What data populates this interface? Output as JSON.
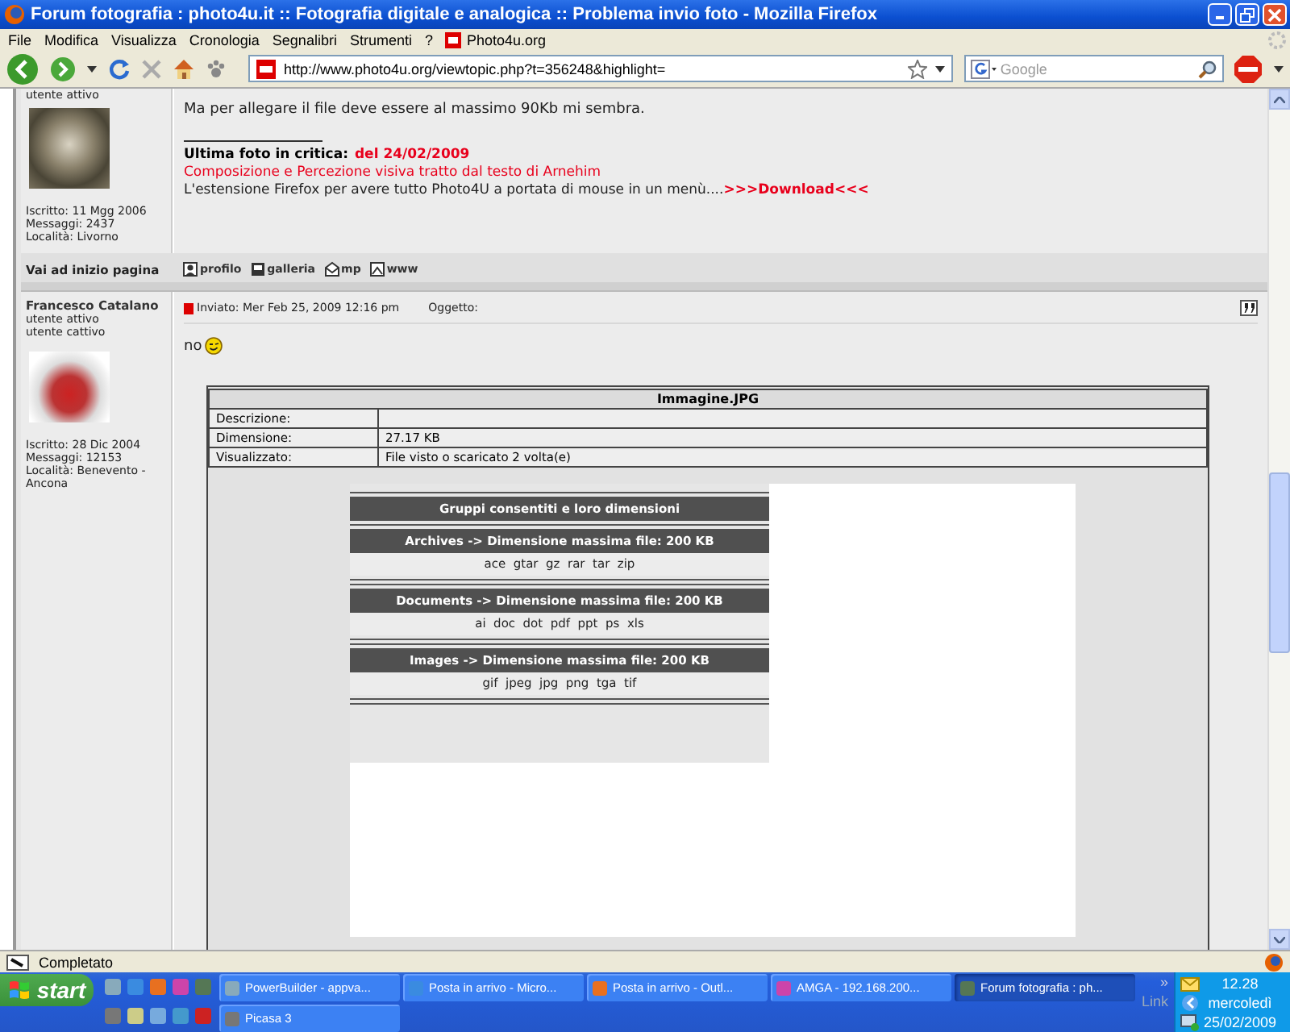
{
  "window": {
    "title": "Forum fotografia : photo4u.it :: Fotografia digitale e analogica :: Problema invio foto - Mozilla Firefox"
  },
  "menu": [
    "File",
    "Modifica",
    "Visualizza",
    "Cronologia",
    "Segnalibri",
    "Strumenti",
    "?",
    "Photo4u.org"
  ],
  "toolbar": {
    "url": "http://www.photo4u.org/viewtopic.php?t=356248&highlight=",
    "search_placeholder": "Google"
  },
  "posts": [
    {
      "ranks": [
        "utente attivo"
      ],
      "stats": [
        "Iscritto: 11 Mgg 2006",
        "Messaggi: 2437",
        "Località: Livorno"
      ],
      "message": "Ma per allegare il file deve essere al massimo 90Kb mi sembra.",
      "signature": {
        "label": "Ultima foto in critica:",
        "label_link": "del 24/02/2009",
        "link": "Composizione e Percezione visiva tratto dal testo di Arnehim",
        "note": "L'estensione Firefox per avere tutto Photo4U a portata di mouse in un menù....",
        "note_link": ">>>Download<<<"
      },
      "back_to_top": "Vai ad inizio pagina",
      "actions": [
        "profilo",
        "galleria",
        "mp",
        "www"
      ]
    },
    {
      "author": "Francesco Catalano",
      "ranks": [
        "utente attivo",
        "utente cattivo"
      ],
      "stats": [
        "Iscritto: 28 Dic 2004",
        "Messaggi: 12153",
        "Località: Benevento - Ancona"
      ],
      "posted": "Inviato: Mer Feb 25, 2009 12:16 pm",
      "subject_label": "Oggetto:",
      "message": "no",
      "attachment": {
        "filename": "Immagine.JPG",
        "rows": [
          {
            "label": "Descrizione:",
            "value": ""
          },
          {
            "label": "Dimensione:",
            "value": "27.17 KB"
          },
          {
            "label": "Visualizzato:",
            "value": "File visto o scaricato 2 volta(e)"
          }
        ],
        "image": {
          "heading": "Gruppi consentiti e loro dimensioni",
          "groups": [
            {
              "title": "Archives -> Dimensione massima file: 200 KB",
              "extensions": "ace  gtar  gz  rar  tar  zip"
            },
            {
              "title": "Documents -> Dimensione massima file: 200 KB",
              "extensions": "ai  doc  dot  pdf  ppt  ps  xls"
            },
            {
              "title": "Images -> Dimensione massima file: 200 KB",
              "extensions": "gif  jpeg  jpg  png  tga  tif"
            }
          ]
        }
      }
    }
  ],
  "status_bar": {
    "text": "Completato"
  },
  "taskbar": {
    "start": "start",
    "tasks": [
      {
        "label": "PowerBuilder - appva...",
        "selected": false
      },
      {
        "label": "Posta in arrivo - Micro...",
        "selected": false
      },
      {
        "label": "Posta in arrivo - Outl...",
        "selected": false
      },
      {
        "label": "AMGA - 192.168.200...",
        "selected": false
      },
      {
        "label": "Forum fotografia : ph...",
        "selected": true
      },
      {
        "label": "Picasa 3",
        "selected": false
      }
    ],
    "more": "»",
    "links_label": "Link",
    "clock": {
      "time": "12.28",
      "day": "mercoledì",
      "date": "25/02/2009"
    }
  }
}
